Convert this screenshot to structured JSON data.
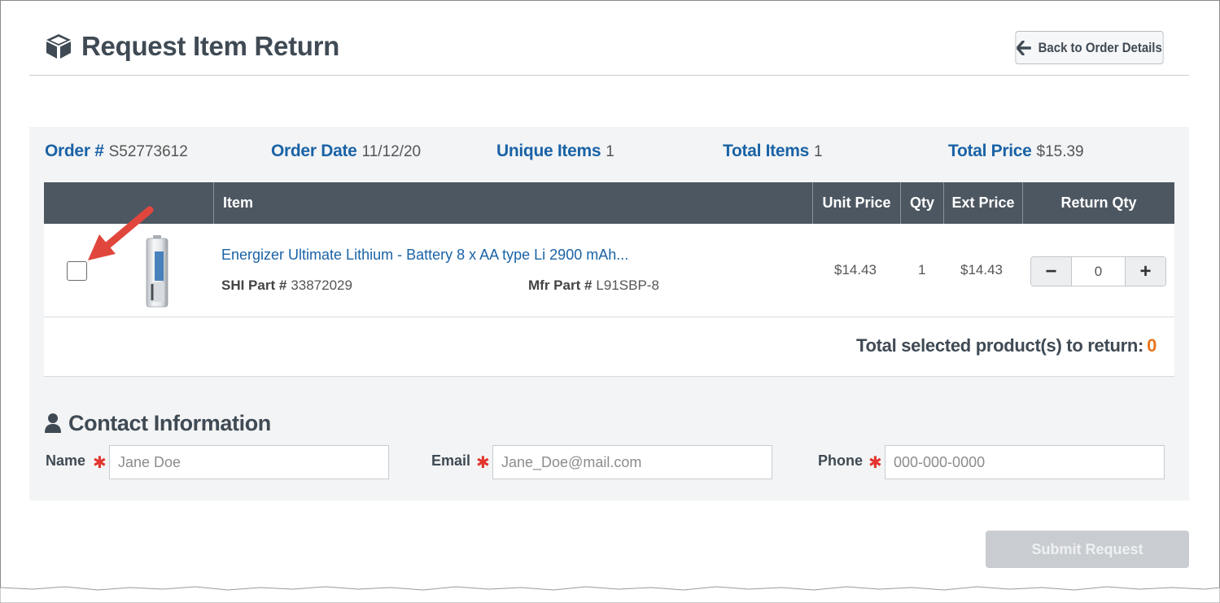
{
  "header": {
    "title": "Request Item Return",
    "back_label": "Back to Order Details",
    "title_icon": "cube-icon",
    "back_icon": "arrow-left-icon"
  },
  "summary": {
    "order_label": "Order #",
    "order_value": "S52773612",
    "date_label": "Order Date",
    "date_value": "11/12/20",
    "unique_label": "Unique Items",
    "unique_value": "1",
    "total_items_label": "Total Items",
    "total_items_value": "1",
    "total_price_label": "Total Price",
    "total_price_value": "$15.39"
  },
  "table": {
    "columns": [
      "",
      "Item",
      "Unit Price",
      "Qty",
      "Ext Price",
      "Return Qty"
    ],
    "rows": [
      {
        "title": "Energizer Ultimate Lithium - Battery 8 x AA type Li 2900 mAh...",
        "shi_label": "SHI Part #",
        "shi_value": "33872029",
        "mfr_label": "Mfr Part #",
        "mfr_value": "L91SBP-8",
        "unit_price": "$14.43",
        "qty": "1",
        "ext_price": "$14.43",
        "return_qty": "0",
        "minus": "−",
        "plus": "+"
      }
    ],
    "total_label": "Total selected product(s) to return:",
    "total_value": "0"
  },
  "contact": {
    "title": "Contact Information",
    "title_icon": "user-icon",
    "name_label": "Name",
    "name_placeholder": "Jane Doe",
    "email_label": "Email",
    "email_placeholder": "Jane_Doe@mail.com",
    "phone_label": "Phone",
    "phone_placeholder": "000-000-0000",
    "required_mark": "✱"
  },
  "actions": {
    "submit_label": "Submit Request"
  },
  "colors": {
    "accent_blue": "#1a63a6",
    "header_bar": "#4d5761",
    "orange": "#e8741c",
    "required_red": "#e2352d",
    "arrow_red": "#e0463c"
  }
}
